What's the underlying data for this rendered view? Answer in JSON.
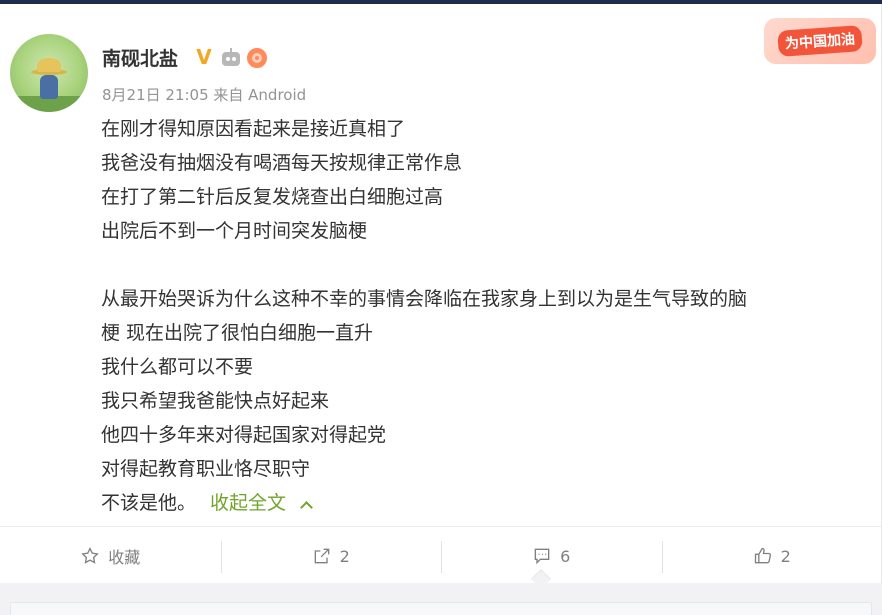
{
  "post": {
    "username": "南砚北盐",
    "meta": "8月21日 21:05 来自 Android",
    "promo_label": "为中国加油",
    "lines": [
      "在刚才得知原因看起来是接近真相了",
      "我爸没有抽烟没有喝酒每天按规律正常作息",
      "在打了第二针后反复发烧查出白细胞过高",
      "出院后不到一个月时间突发脑梗",
      "",
      "从最开始哭诉为什么这种不幸的事情会降临在我家身上到以为是生气导致的脑",
      "梗  现在出院了很怕白细胞一直升",
      "我什么都可以不要",
      "我只希望我爸能快点好起来",
      "他四十多年来对得起国家对得起党",
      "对得起教育职业恪尽职守"
    ],
    "last_line": "不该是他。",
    "collapse_label": "收起全文"
  },
  "actions": {
    "favorite": "收藏",
    "repost": "2",
    "comment": "6",
    "like": "2"
  },
  "icons": {
    "verified": "verified-v-icon",
    "robot": "robot-badge-icon",
    "donut": "donut-badge-icon",
    "star": "star-icon",
    "share": "share-icon",
    "comment": "comment-icon",
    "like": "thumbs-up-icon"
  },
  "colors": {
    "accent_green": "#71a42b",
    "verified_gold": "#f5a623",
    "promo_red": "#f2553a"
  }
}
